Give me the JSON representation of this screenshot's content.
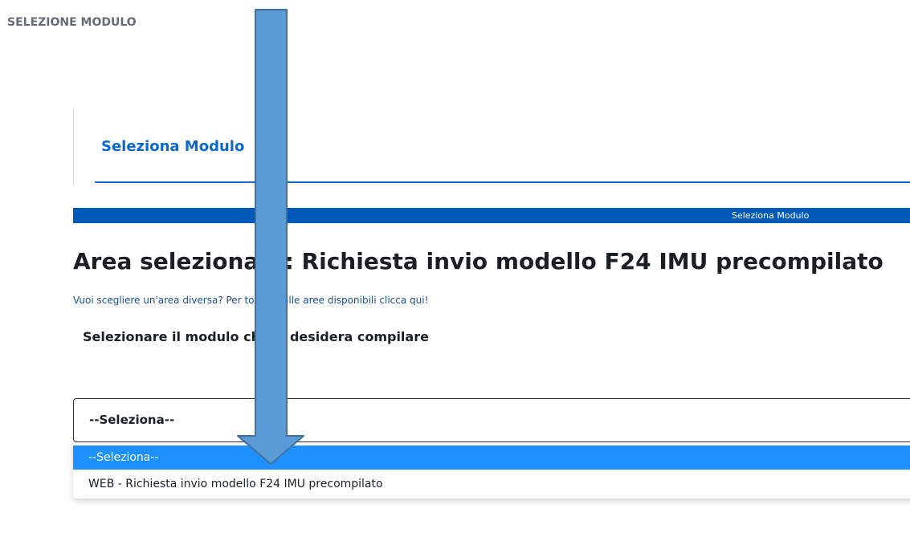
{
  "header": {
    "title": "SELEZIONE MODULO"
  },
  "tab": {
    "label": "Seleziona Modulo"
  },
  "progress": {
    "step_label": "Seleziona Modulo",
    "color": "#0058b8"
  },
  "area": {
    "title": "Area selezionata: Richiesta invio modello F24 IMU precompilato",
    "change_link": "Vuoi scegliere un'area diversa? Per tornare alle aree disponibili clicca qui!"
  },
  "form": {
    "instruction": "Selezionare il modulo che si desidera compilare",
    "select": {
      "value": "--Seleziona--",
      "options": [
        {
          "label": "--Seleziona--",
          "highlighted": true
        },
        {
          "label": "WEB - Richiesta invio modello F24 IMU precompilato",
          "highlighted": false
        }
      ]
    }
  },
  "annotation": {
    "icon": "down-arrow-annotation",
    "fill": "#5b9bd5",
    "stroke": "#41719c"
  },
  "colors": {
    "accent": "#0a68cd",
    "option_highlight": "#1e90ff"
  }
}
